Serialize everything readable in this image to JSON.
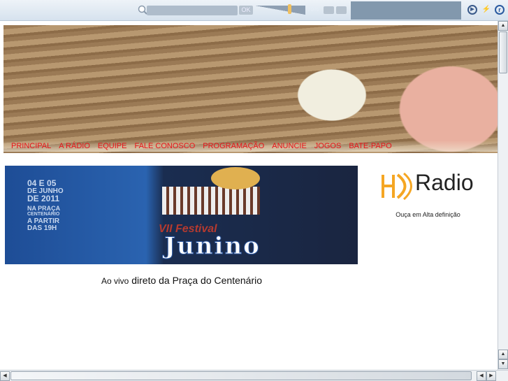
{
  "toolbar": {
    "ok_label": "OK",
    "volume_percent": "70%",
    "volume_level": 0.65
  },
  "nav": [
    "PRINCIPAL",
    "A RÁDIO",
    "EQUIPE",
    "FALE CONOSCO",
    "PROGRAMAÇÃO",
    "ANUNCIE",
    "JOGOS",
    "BATE-PAPO"
  ],
  "poster": {
    "date1": "04 E 05",
    "date2": "DE JUNHO",
    "date3": "DE 2011",
    "place1": "NA PRAÇA",
    "place2": "CENTENÁRIO",
    "time1": "A PARTIR",
    "time2": "DAS 19H",
    "title1": "VII Festival",
    "title2": "Junino"
  },
  "caption": {
    "small": "Ao vivo",
    "large": "direto da Praça do Centenário"
  },
  "hd": {
    "logo": "HD Radio",
    "subtitle": "Ouça em Alta definição"
  },
  "colors": {
    "nav": "#e8141a",
    "hd_orange": "#f5a623"
  }
}
